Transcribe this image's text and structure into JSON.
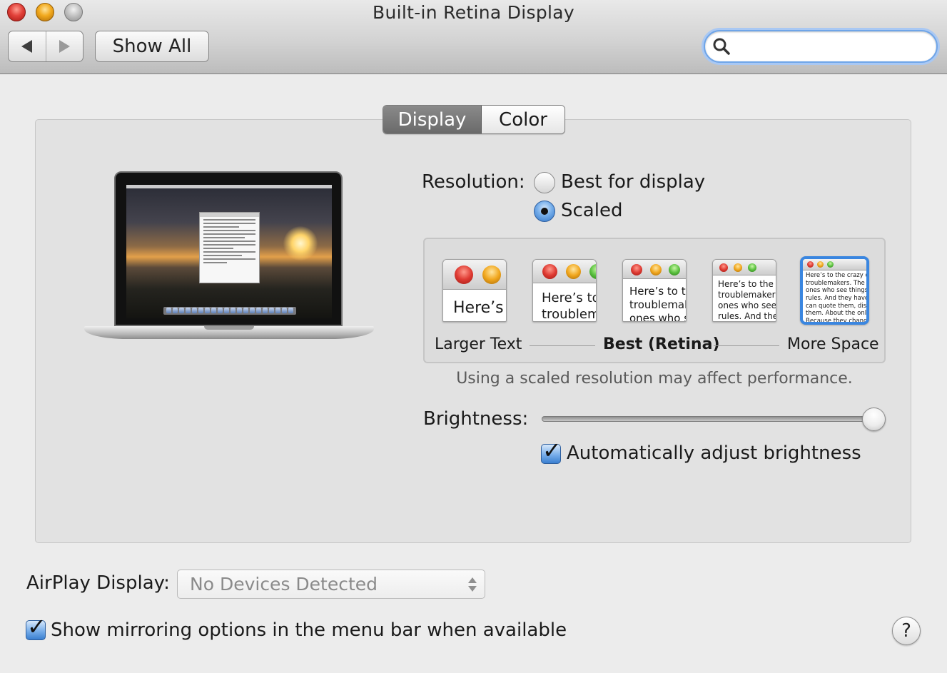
{
  "window": {
    "title": "Built-in Retina Display"
  },
  "toolbar": {
    "back_icon": "chevron-left-icon",
    "forward_icon": "chevron-right-icon",
    "show_all_label": "Show All",
    "search_placeholder": "",
    "search_icon": "search-icon"
  },
  "tabs": [
    {
      "label": "Display",
      "active": true
    },
    {
      "label": "Color",
      "active": false
    }
  ],
  "resolution": {
    "label": "Resolution:",
    "options": [
      {
        "label": "Best for display",
        "selected": false
      },
      {
        "label": "Scaled",
        "selected": true
      }
    ],
    "scale_thumbnails": [
      {
        "text": "Here’s",
        "selected": false
      },
      {
        "text": "Here’s to\ntroublem",
        "selected": false
      },
      {
        "text": "Here’s to th\ntroublemak\nones who s",
        "selected": false
      },
      {
        "text": "Here’s to the cr\ntroublemakers.\nones who see t\nrules. And they",
        "selected": false
      },
      {
        "text": "Here’s to the crazy one\ntroublemakers. The rou\nones who see things di\nrules. And they have no\ncan quote them, disagr\nthem. About the only t\nBecause they change th",
        "selected": true
      }
    ],
    "scale_labels": {
      "left": "Larger Text",
      "middle": "Best (Retina)",
      "right": "More Space"
    },
    "performance_note": "Using a scaled resolution may affect performance."
  },
  "brightness": {
    "label": "Brightness:",
    "level": 1.0,
    "auto_adjust_label": "Automatically adjust brightness",
    "auto_adjust_checked": true
  },
  "airplay": {
    "label": "AirPlay Display:",
    "selected_value": "No Devices Detected"
  },
  "mirroring": {
    "label": "Show mirroring options in the menu bar when available",
    "checked": true
  },
  "help": {
    "label": "?"
  },
  "colors": {
    "accent": "#3a86e0",
    "close": "#e2413a",
    "minimize": "#f2a91d"
  }
}
